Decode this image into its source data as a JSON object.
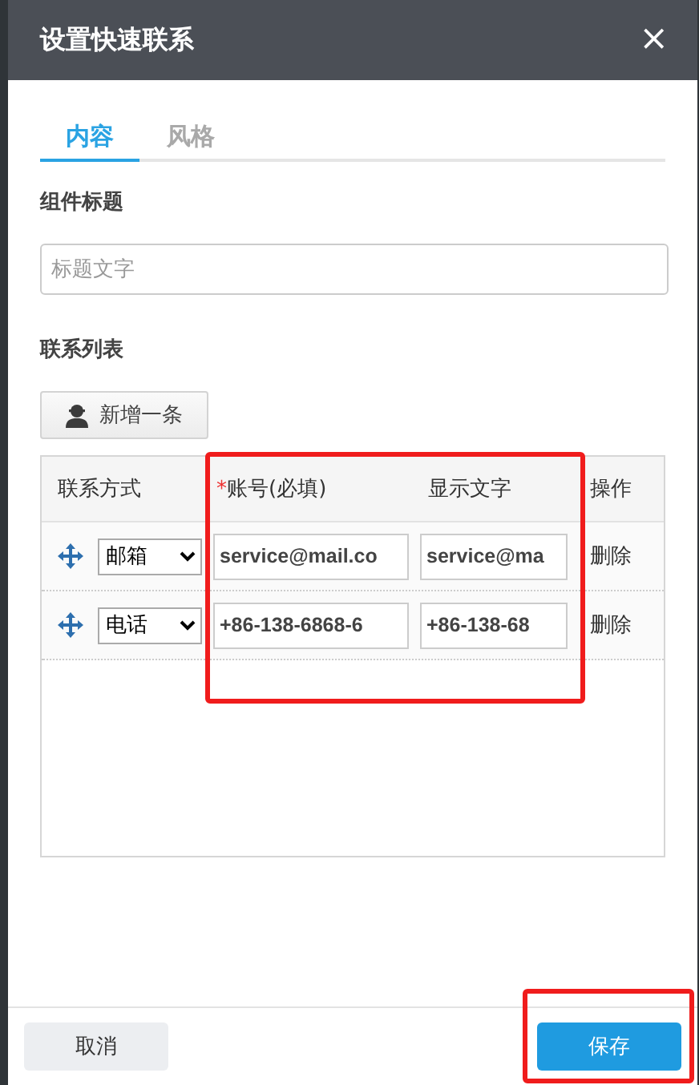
{
  "dialog": {
    "title": "设置快速联系",
    "close": "×"
  },
  "tabs": [
    {
      "label": "内容",
      "selected": true
    },
    {
      "label": "风格",
      "selected": false
    }
  ],
  "title_field": {
    "label": "组件标题",
    "placeholder": "标题文字"
  },
  "contacts": {
    "label": "联系列表",
    "add_button": "新增一条",
    "columns": [
      {
        "label": "联系方式",
        "required": false
      },
      {
        "label": "账号(必填)",
        "required": true
      },
      {
        "label": "显示文字",
        "required": false
      },
      {
        "label": "操作",
        "required": false
      }
    ],
    "required_mark": "*",
    "highlight_columns": true,
    "rows": [
      {
        "type": "邮箱",
        "account": "service@mail.co",
        "display": "service@ma",
        "action": "删除"
      },
      {
        "type": "电话",
        "account": "+86-138-6868-6",
        "display": "+86-138-68",
        "action": "删除"
      }
    ]
  },
  "footer": {
    "cancel": "取消",
    "save": "保存",
    "highlight_save": true
  }
}
